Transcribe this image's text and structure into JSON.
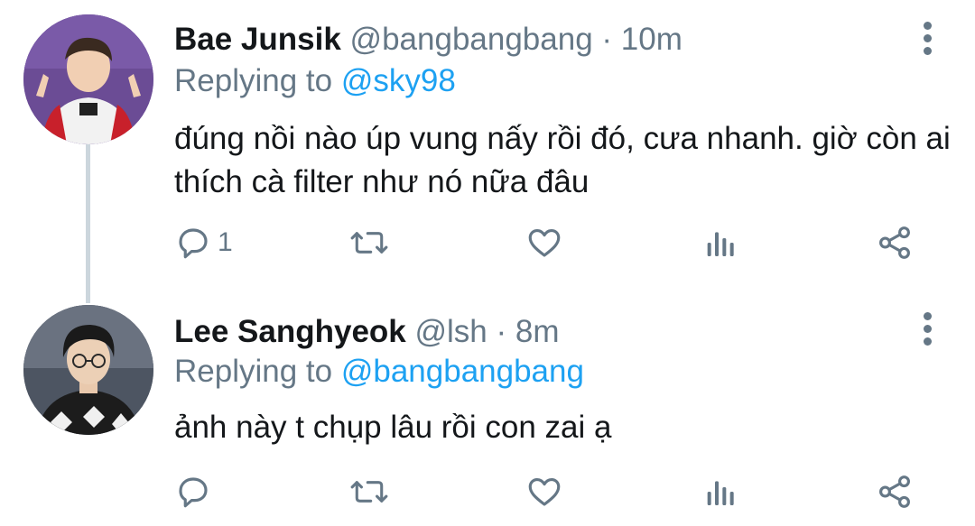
{
  "tweets": [
    {
      "author_name": "Bae Junsik",
      "handle": "@bangbangbang",
      "separator": "·",
      "time": "10m",
      "replying_prefix": "Replying to",
      "replying_to": "@sky98",
      "text": "đúng nồi nào úp vung nấy rồi đó, cưa nhanh. giờ còn ai thích cà filter như nó nữa đâu",
      "reply_count": "1"
    },
    {
      "author_name": "Lee Sanghyeok",
      "handle": "@lsh",
      "separator": "·",
      "time": "8m",
      "replying_prefix": "Replying to",
      "replying_to": "@bangbangbang",
      "text": "ảnh này t chụp lâu rồi con zai ạ",
      "reply_count": ""
    }
  ],
  "icons": {
    "reply": "reply-icon",
    "retweet": "retweet-icon",
    "like": "heart-icon",
    "analytics": "analytics-icon",
    "share": "share-icon",
    "more": "more-vertical-icon"
  },
  "colors": {
    "link": "#1da1f2",
    "secondary": "#657786",
    "thread_line": "#ccd6dd"
  }
}
